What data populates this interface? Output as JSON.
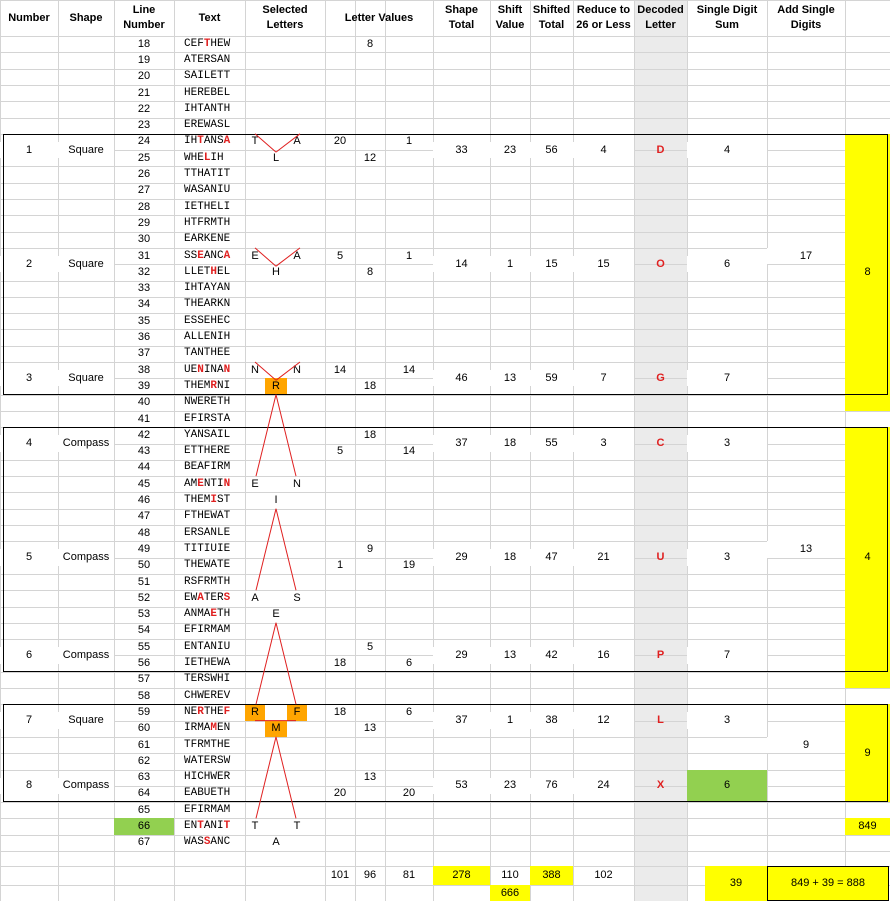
{
  "headers": {
    "number": "Number",
    "shape": "Shape",
    "line_number": "Line Number",
    "text": "Text",
    "selected": "Selected Letters",
    "values": "Letter Values",
    "shape_total": "Shape Total",
    "shift": "Shift Value",
    "shifted": "Shifted Total",
    "reduce": "Reduce to 26 or Less",
    "decoded": "Decoded Letter",
    "single": "Single Digit Sum",
    "add": "Add Single Digits"
  },
  "lines": [
    {
      "n": "18",
      "t": [
        "CEF",
        "T",
        "HEW"
      ]
    },
    {
      "n": "19",
      "t": [
        "ATERSAN"
      ]
    },
    {
      "n": "20",
      "t": [
        "SAILETT"
      ]
    },
    {
      "n": "21",
      "t": [
        "HEREBEL"
      ]
    },
    {
      "n": "22",
      "t": [
        "IHTANTH"
      ]
    },
    {
      "n": "23",
      "t": [
        "EREWASL"
      ]
    },
    {
      "n": "24",
      "t": [
        "IH",
        "T",
        "ANS",
        "A",
        ""
      ]
    },
    {
      "n": "25",
      "t": [
        "WHE",
        "L",
        "IH"
      ]
    },
    {
      "n": "26",
      "t": [
        "TTHATIT"
      ]
    },
    {
      "n": "27",
      "t": [
        "WASANIU"
      ]
    },
    {
      "n": "28",
      "t": [
        "IETHELI"
      ]
    },
    {
      "n": "29",
      "t": [
        "HTFRMTH"
      ]
    },
    {
      "n": "30",
      "t": [
        "EARKENE"
      ]
    },
    {
      "n": "31",
      "t": [
        "SS",
        "E",
        "ANC",
        "A",
        ""
      ]
    },
    {
      "n": "32",
      "t": [
        "LLET",
        "H",
        "EL"
      ]
    },
    {
      "n": "33",
      "t": [
        "IHTAYAN"
      ]
    },
    {
      "n": "34",
      "t": [
        "THEARKN"
      ]
    },
    {
      "n": "35",
      "t": [
        "ESSEHEC"
      ]
    },
    {
      "n": "36",
      "t": [
        "ALLENIH"
      ]
    },
    {
      "n": "37",
      "t": [
        "TANTHEE"
      ]
    },
    {
      "n": "38",
      "t": [
        "UE",
        "N",
        "INA",
        "N",
        ""
      ]
    },
    {
      "n": "39",
      "t": [
        "THEM",
        "R",
        "NI"
      ]
    },
    {
      "n": "40",
      "t": [
        "NWERETH"
      ]
    },
    {
      "n": "41",
      "t": [
        "EFIRSTA"
      ]
    },
    {
      "n": "42",
      "t": [
        "YANSAIL"
      ]
    },
    {
      "n": "43",
      "t": [
        "ETTHERE"
      ]
    },
    {
      "n": "44",
      "t": [
        "BEAFIRM"
      ]
    },
    {
      "n": "45",
      "t": [
        "AM",
        "E",
        "NTI",
        "N",
        ""
      ]
    },
    {
      "n": "46",
      "t": [
        "THEM",
        "I",
        "ST"
      ]
    },
    {
      "n": "47",
      "t": [
        "FTHEWAT"
      ]
    },
    {
      "n": "48",
      "t": [
        "ERSANLE"
      ]
    },
    {
      "n": "49",
      "t": [
        "TITIUIE"
      ]
    },
    {
      "n": "50",
      "t": [
        "THEWATE"
      ]
    },
    {
      "n": "51",
      "t": [
        "RSFRMTH"
      ]
    },
    {
      "n": "52",
      "t": [
        "EW",
        "A",
        "TER",
        "S",
        ""
      ]
    },
    {
      "n": "53",
      "t": [
        "ANMA",
        "E",
        "TH"
      ]
    },
    {
      "n": "54",
      "t": [
        "EFIRMAM"
      ]
    },
    {
      "n": "55",
      "t": [
        "ENTANIU"
      ]
    },
    {
      "n": "56",
      "t": [
        "IETHEWA"
      ]
    },
    {
      "n": "57",
      "t": [
        "TERSWHI"
      ]
    },
    {
      "n": "58",
      "t": [
        "CHWEREV"
      ]
    },
    {
      "n": "59",
      "t": [
        "NE",
        "R",
        "THE",
        "F",
        ""
      ]
    },
    {
      "n": "60",
      "t": [
        "IRMA",
        "M",
        "EN"
      ]
    },
    {
      "n": "61",
      "t": [
        "TFRMTHE"
      ]
    },
    {
      "n": "62",
      "t": [
        "WATERSW"
      ]
    },
    {
      "n": "63",
      "t": [
        "HICHWER"
      ]
    },
    {
      "n": "64",
      "t": [
        "EABUETH"
      ]
    },
    {
      "n": "65",
      "t": [
        "EFIRMAM"
      ]
    },
    {
      "n": "66",
      "t": [
        "EN",
        "T",
        "ANI",
        "T",
        ""
      ]
    },
    {
      "n": "67",
      "t": [
        "WAS",
        "S",
        "ANC"
      ]
    }
  ],
  "rows": [
    {
      "num": "1",
      "shape": "Square",
      "total": "33",
      "shift": "23",
      "shifted": "56",
      "reduce": "4",
      "letter": "D",
      "single": "4"
    },
    {
      "num": "2",
      "shape": "Square",
      "total": "14",
      "shift": "1",
      "shifted": "15",
      "reduce": "15",
      "letter": "O",
      "single": "6"
    },
    {
      "num": "3",
      "shape": "Square",
      "total": "46",
      "shift": "13",
      "shifted": "59",
      "reduce": "7",
      "letter": "G",
      "single": "7"
    },
    {
      "num": "4",
      "shape": "Compass",
      "total": "37",
      "shift": "18",
      "shifted": "55",
      "reduce": "3",
      "letter": "C",
      "single": "3"
    },
    {
      "num": "5",
      "shape": "Compass",
      "total": "29",
      "shift": "18",
      "shifted": "47",
      "reduce": "21",
      "letter": "U",
      "single": "3"
    },
    {
      "num": "6",
      "shape": "Compass",
      "total": "29",
      "shift": "13",
      "shifted": "42",
      "reduce": "16",
      "letter": "P",
      "single": "7"
    },
    {
      "num": "7",
      "shape": "Square",
      "total": "37",
      "shift": "1",
      "shifted": "38",
      "reduce": "12",
      "letter": "L",
      "single": "3"
    },
    {
      "num": "8",
      "shape": "Compass",
      "total": "53",
      "shift": "23",
      "shifted": "76",
      "reduce": "24",
      "letter": "X",
      "single": "6"
    }
  ],
  "selected": {
    "r24": [
      "T",
      "A"
    ],
    "r25": "L",
    "r31": [
      "E",
      "A"
    ],
    "r32": "H",
    "r38": [
      "N",
      "N"
    ],
    "r39": "R",
    "r45": [
      "E",
      "N"
    ],
    "r46": "I",
    "r52": [
      "A",
      "S"
    ],
    "r53": "E",
    "r59": [
      "R",
      "F"
    ],
    "r60": "M",
    "r66": [
      "T",
      "T"
    ],
    "r67": "A"
  },
  "values": {
    "r18": "8",
    "r24": [
      "20",
      "1"
    ],
    "r25": "12",
    "r31": [
      "5",
      "1"
    ],
    "r32": "8",
    "r38": [
      "14",
      "14"
    ],
    "r39": "18",
    "r42": "18",
    "r43": [
      "5",
      "14"
    ],
    "r49": "9",
    "r50": [
      "1",
      "19"
    ],
    "r55": "5",
    "r56": [
      "18",
      "6"
    ],
    "r59": [
      "18",
      "6"
    ],
    "r60": "13",
    "r63": "13",
    "r64": [
      "20",
      "20"
    ]
  },
  "groups": {
    "g1": "17",
    "g1y": "8",
    "g2": "13",
    "g2y": "4",
    "g3": "9",
    "g3y": "9",
    "extra": "849"
  },
  "totals": {
    "v1": "101",
    "v2": "96",
    "v3": "81",
    "shape": "278",
    "shift": "110",
    "shift2": "666",
    "shifted": "388",
    "reduce": "102",
    "single": "39",
    "final": "849 + 39 = 888"
  },
  "colors": {
    "red": "#e02020",
    "yellow": "#ffff00",
    "orange": "#ffa500",
    "green": "#92d050",
    "grey": "#ebebeb"
  }
}
